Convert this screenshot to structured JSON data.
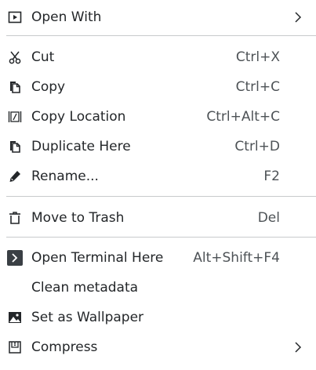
{
  "menu": {
    "open_with": {
      "label": "Open With",
      "icon": "open-with-icon",
      "submenu_icon": "chevron-right-icon"
    },
    "cut": {
      "label": "Cut",
      "shortcut": "Ctrl+X",
      "icon": "scissors-icon"
    },
    "copy": {
      "label": "Copy",
      "shortcut": "Ctrl+C",
      "icon": "copy-icon"
    },
    "copy_location": {
      "label": "Copy Location",
      "shortcut": "Ctrl+Alt+C",
      "icon": "copy-location-icon"
    },
    "duplicate_here": {
      "label": "Duplicate Here",
      "shortcut": "Ctrl+D",
      "icon": "duplicate-icon"
    },
    "rename": {
      "label": "Rename...",
      "shortcut": "F2",
      "icon": "pencil-icon"
    },
    "move_to_trash": {
      "label": "Move to Trash",
      "shortcut": "Del",
      "icon": "trash-icon"
    },
    "open_terminal_here": {
      "label": "Open Terminal Here",
      "shortcut": "Alt+Shift+F4",
      "icon": "terminal-icon"
    },
    "clean_metadata": {
      "label": "Clean metadata"
    },
    "set_as_wallpaper": {
      "label": "Set as Wallpaper",
      "icon": "image-icon"
    },
    "compress": {
      "label": "Compress",
      "icon": "archive-icon",
      "submenu_icon": "chevron-right-icon"
    }
  },
  "colors": {
    "text": "#232629",
    "shortcut_text": "#4d5256",
    "separator": "#c8cacc",
    "terminal_icon_bg": "#3a3f44"
  }
}
